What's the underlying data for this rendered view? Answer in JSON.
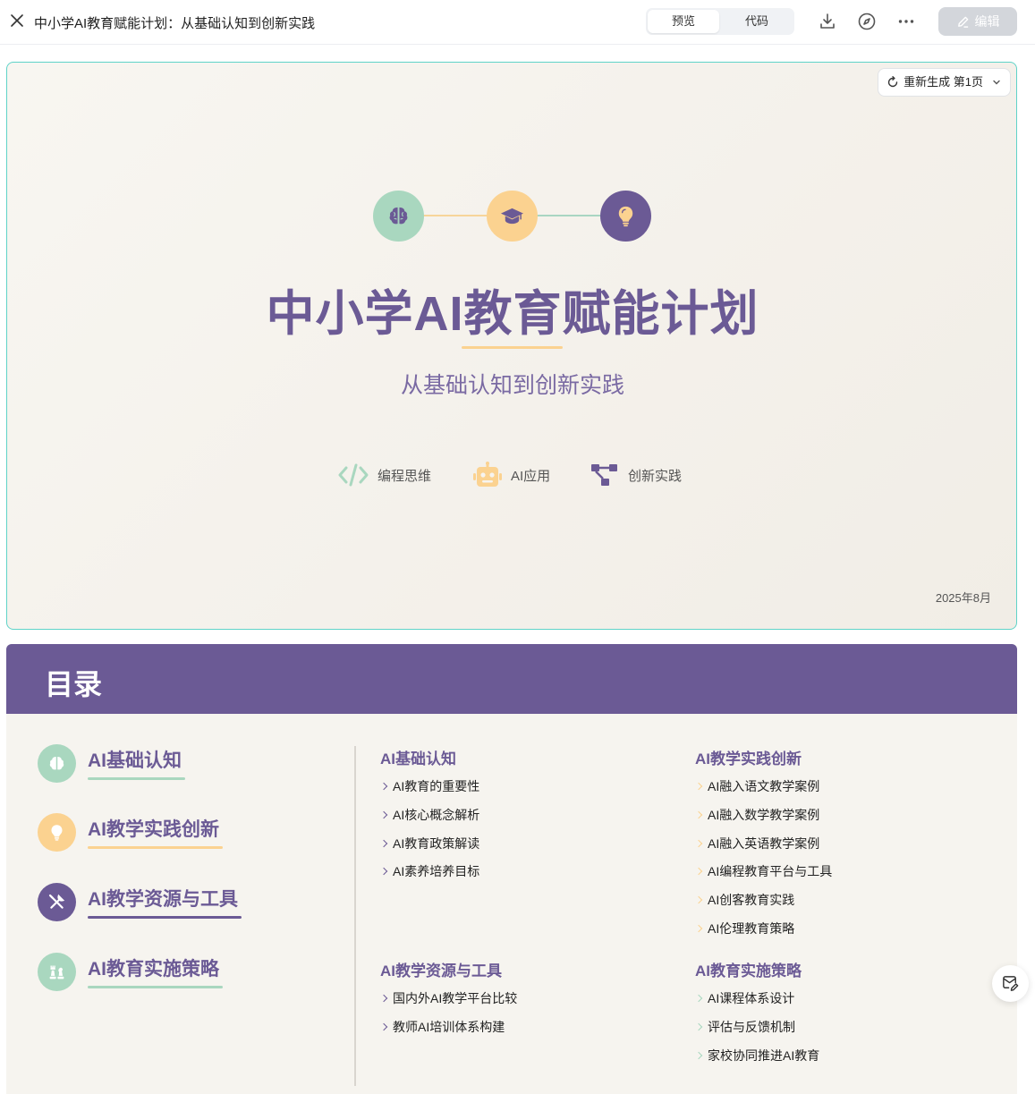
{
  "topbar": {
    "title": "中小学AI教育赋能计划：从基础认知到创新实践",
    "tabs": [
      {
        "label": "预览",
        "active": true
      },
      {
        "label": "代码",
        "active": false
      }
    ],
    "edit_label": "编辑",
    "icons": [
      "close-icon",
      "download-icon",
      "compass-icon",
      "more-icon",
      "pencil-icon"
    ]
  },
  "slide1": {
    "regen_label": "重新生成 第1页",
    "title": "中小学AI教育赋能计划",
    "subtitle": "从基础认知到创新实践",
    "features": [
      {
        "label": "编程思维",
        "icon": "code-icon"
      },
      {
        "label": "AI应用",
        "icon": "robot-icon"
      },
      {
        "label": "创新实践",
        "icon": "network-icon"
      }
    ],
    "date": "2025年8月",
    "hero_icons": [
      "brain-icon",
      "graduation-cap-icon",
      "lightbulb-icon"
    ]
  },
  "slide2": {
    "header": "目录",
    "toc": [
      {
        "label": "AI基础认知",
        "icon": "brain-icon",
        "color": "#a9d7bf"
      },
      {
        "label": "AI教学实践创新",
        "icon": "lightbulb-icon",
        "color": "#fbd290"
      },
      {
        "label": "AI教学资源与工具",
        "icon": "tools-icon",
        "color": "#6b5a95"
      },
      {
        "label": "AI教育实施策略",
        "icon": "chess-icon",
        "color": "#a9d7bf"
      }
    ],
    "sections": [
      {
        "title": "AI基础认知",
        "items": [
          "AI教育的重要性",
          "AI核心概念解析",
          "AI教育政策解读",
          "AI素养培养目标"
        ]
      },
      {
        "title": "AI教学实践创新",
        "items": [
          "AI融入语文教学案例",
          "AI融入数学教学案例",
          "AI融入英语教学案例",
          "AI编程教育平台与工具",
          "AI创客教育实践",
          "AI伦理教育策略"
        ]
      },
      {
        "title": "AI教学资源与工具",
        "items": [
          "国内外AI教学平台比较",
          "教师AI培训体系构建"
        ]
      },
      {
        "title": "AI教育实施策略",
        "items": [
          "AI课程体系设计",
          "评估与反馈机制",
          "家校协同推进AI教育"
        ]
      }
    ],
    "colors": {
      "purple": "#6b5a95",
      "green": "#a9d7bf",
      "yellow": "#fbd290"
    }
  }
}
